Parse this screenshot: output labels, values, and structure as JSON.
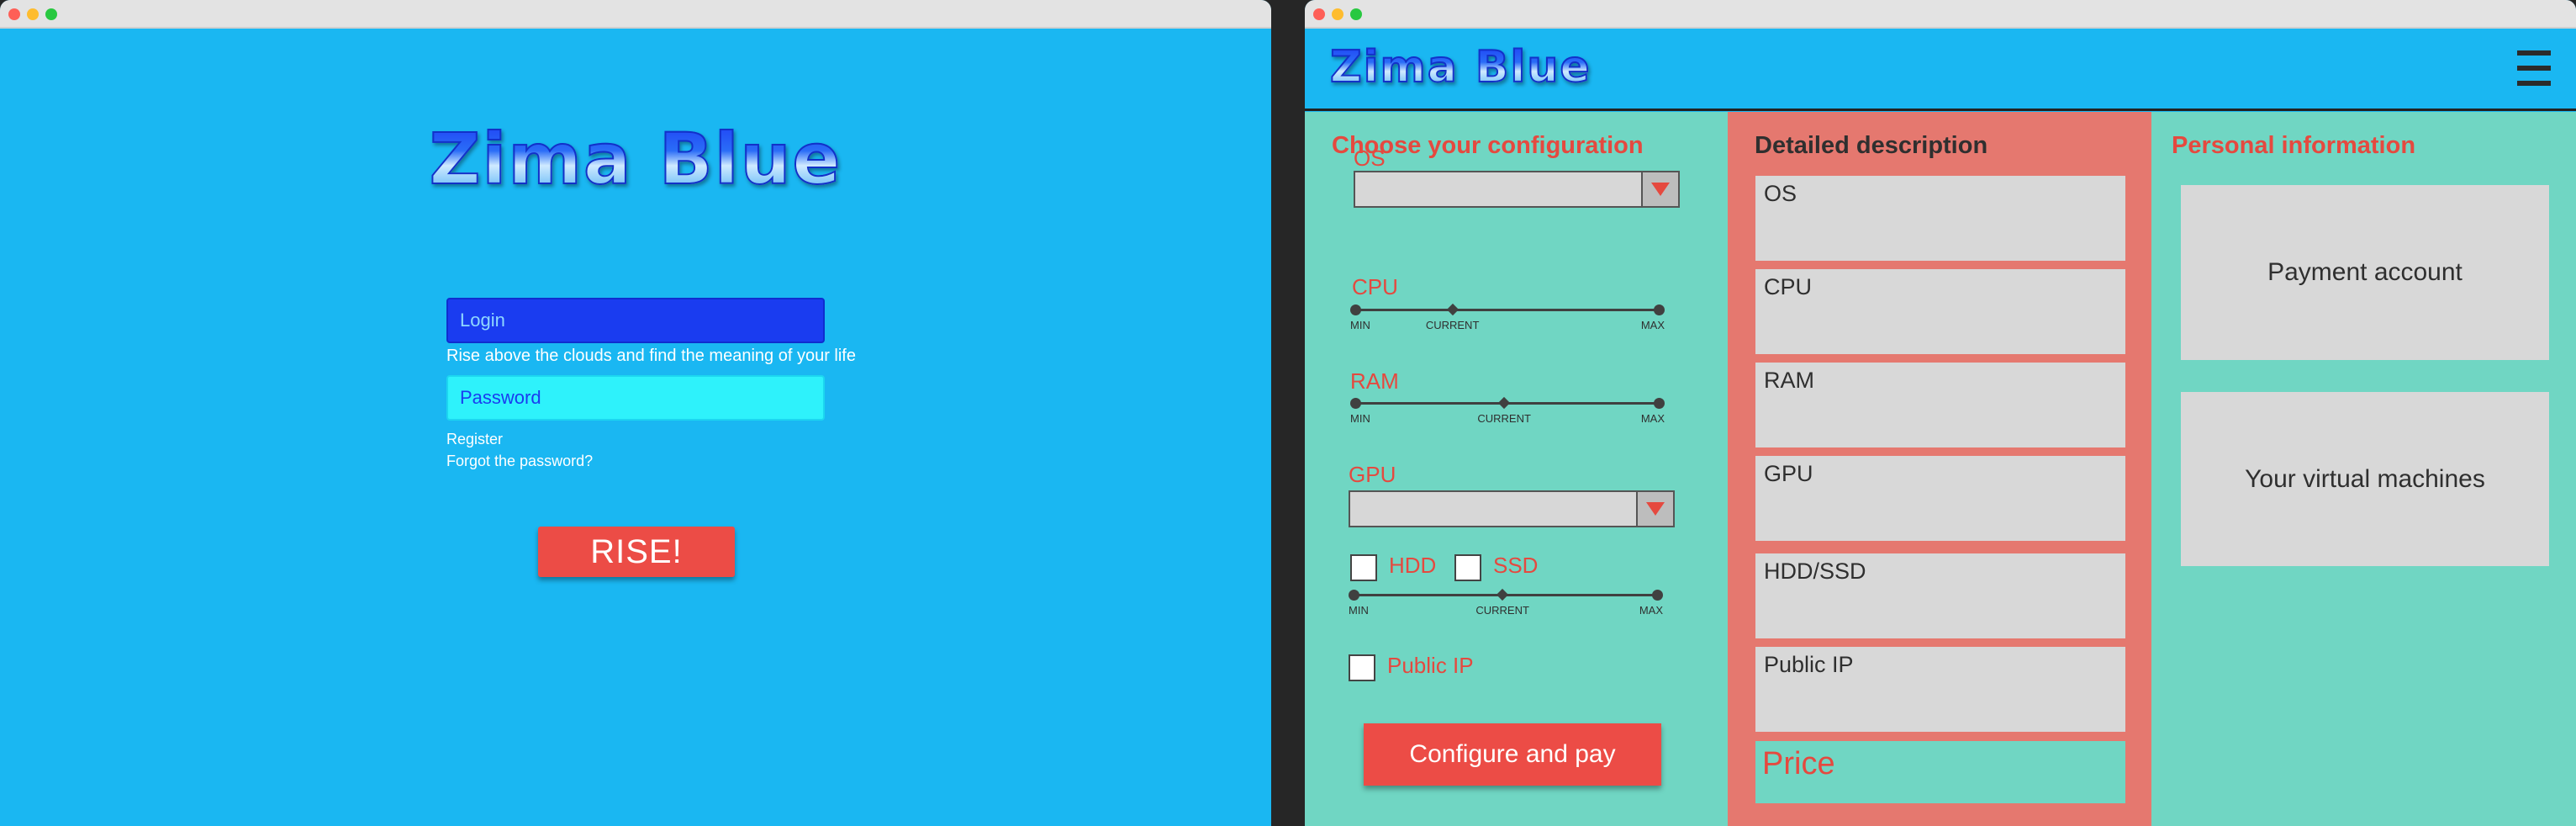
{
  "login_screen": {
    "logo": "Zima Blue",
    "login_placeholder": "Login",
    "tagline": "Rise above the clouds and find the meaning of your life",
    "password_placeholder": "Password",
    "register_link": "Register",
    "forgot_link": "Forgot the password?",
    "submit_label": "RISE!"
  },
  "config_screen": {
    "logo": "Zima Blue",
    "configuration": {
      "title": "Choose your configuration",
      "os_label": "OS",
      "os_value": "",
      "cpu_label": "CPU",
      "cpu_level": 0.32,
      "ram_label": "RAM",
      "ram_level": 0.49,
      "gpu_label": "GPU",
      "gpu_value": "",
      "hdd_label": "HDD",
      "hdd_checked": false,
      "ssd_label": "SSD",
      "ssd_checked": false,
      "storage_level": 0.49,
      "public_ip_label": "Public IP",
      "public_ip_checked": false,
      "slider_min": "MIN",
      "slider_current": "CURRENT",
      "slider_max": "MAX",
      "submit_label": "Configure and pay"
    },
    "description": {
      "title": "Detailed description",
      "items": [
        "OS",
        "CPU",
        "RAM",
        "GPU",
        "HDD/SSD",
        "Public IP"
      ],
      "price_label": "Price"
    },
    "personal": {
      "title": "Personal information",
      "payment_account": "Payment account",
      "virtual_machines": "Your virtual machines"
    }
  },
  "colors": {
    "sky_blue": "#1ab7f2",
    "teal": "#70d6c3",
    "salmon": "#e5786f",
    "accent_red": "#ec4c46",
    "login_field": "#1a3cf0",
    "password_field": "#2ef2fb"
  }
}
